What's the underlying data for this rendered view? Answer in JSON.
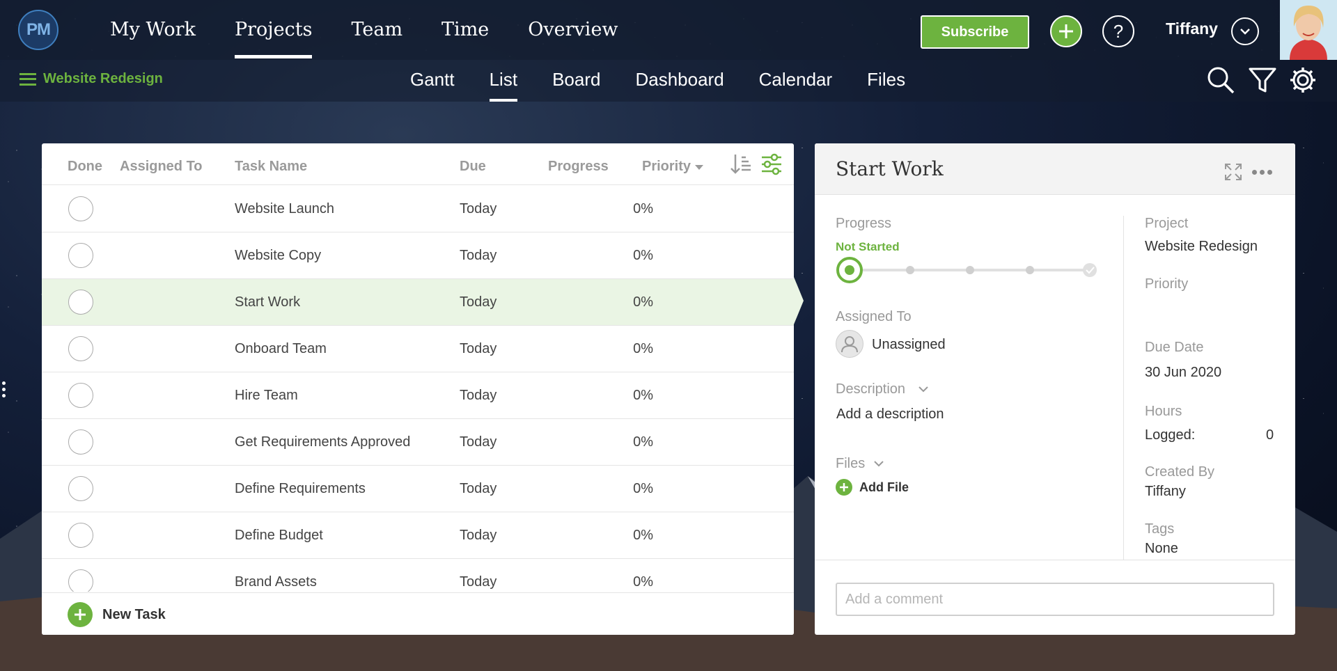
{
  "logo": {
    "text": "PM"
  },
  "main_nav": [
    {
      "label": "My Work",
      "active": false
    },
    {
      "label": "Projects",
      "active": true
    },
    {
      "label": "Team",
      "active": false
    },
    {
      "label": "Time",
      "active": false
    },
    {
      "label": "Overview",
      "active": false
    }
  ],
  "header": {
    "subscribe_label": "Subscribe",
    "help_glyph": "?",
    "user_name": "Tiffany"
  },
  "project": {
    "name": "Website Redesign"
  },
  "view_tabs": [
    {
      "label": "Gantt",
      "active": false
    },
    {
      "label": "List",
      "active": true
    },
    {
      "label": "Board",
      "active": false
    },
    {
      "label": "Dashboard",
      "active": false
    },
    {
      "label": "Calendar",
      "active": false
    },
    {
      "label": "Files",
      "active": false
    }
  ],
  "list": {
    "columns": {
      "done": "Done",
      "assigned": "Assigned To",
      "task": "Task Name",
      "due": "Due",
      "progress": "Progress",
      "priority": "Priority"
    },
    "rows": [
      {
        "name": "Website Launch",
        "due": "Today",
        "progress": "0%",
        "selected": false
      },
      {
        "name": "Website Copy",
        "due": "Today",
        "progress": "0%",
        "selected": false
      },
      {
        "name": "Start Work",
        "due": "Today",
        "progress": "0%",
        "selected": true
      },
      {
        "name": "Onboard Team",
        "due": "Today",
        "progress": "0%",
        "selected": false
      },
      {
        "name": "Hire Team",
        "due": "Today",
        "progress": "0%",
        "selected": false
      },
      {
        "name": "Get Requirements Approved",
        "due": "Today",
        "progress": "0%",
        "selected": false
      },
      {
        "name": "Define Requirements",
        "due": "Today",
        "progress": "0%",
        "selected": false
      },
      {
        "name": "Define Budget",
        "due": "Today",
        "progress": "0%",
        "selected": false
      },
      {
        "name": "Brand Assets",
        "due": "Today",
        "progress": "0%",
        "selected": false
      }
    ],
    "new_task_label": "New Task"
  },
  "detail": {
    "title": "Start Work",
    "progress_label": "Progress",
    "progress_status": "Not Started",
    "assigned_label": "Assigned To",
    "assigned_value": "Unassigned",
    "description_label": "Description",
    "description_placeholder": "Add a description",
    "files_label": "Files",
    "add_file_label": "Add File",
    "project_label": "Project",
    "project_value": "Website Redesign",
    "priority_label": "Priority",
    "due_label": "Due Date",
    "due_value": "30 Jun 2020",
    "hours_label": "Hours",
    "logged_label": "Logged:",
    "logged_value": "0",
    "created_label": "Created By",
    "created_value": "Tiffany",
    "tags_label": "Tags",
    "tags_value": "None",
    "comment_placeholder": "Add a comment"
  },
  "colors": {
    "accent_green": "#6db33f",
    "selected_row": "#eaf5e4",
    "nav_bg": "#121c2e"
  }
}
